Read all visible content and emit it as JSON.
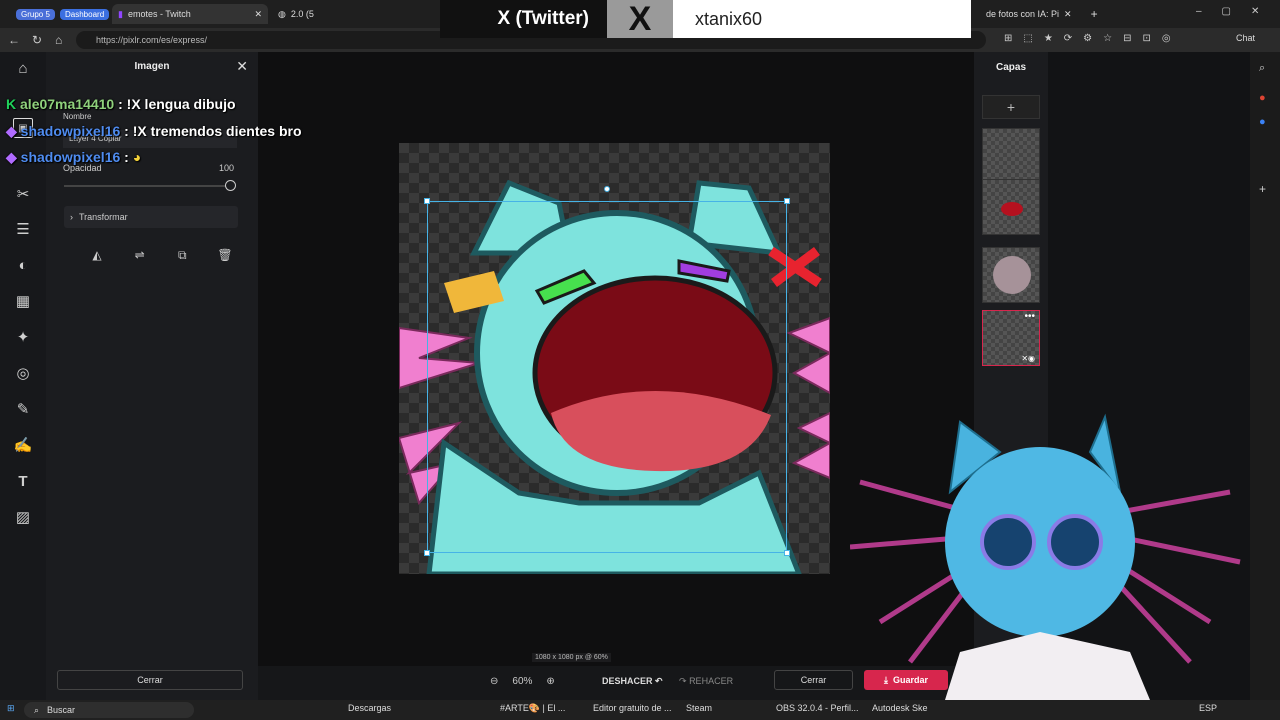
{
  "browser": {
    "tabs": [
      {
        "group": "Grupo 5",
        "group_color": "#4a6fd8"
      },
      {
        "group": "Dashboard",
        "group_color": "#3b6fe0"
      },
      {
        "title": "emotes - Twitch"
      },
      {
        "title": "2.0 (5"
      },
      {
        "title": "de fotos con IA: Pi"
      }
    ],
    "url": "https://pixlr.com/es/express/",
    "chat_button": "Chat"
  },
  "overlay": {
    "twitter_label": "X (Twitter)",
    "twitter_logo": "X",
    "twitter_user": "xtanix60"
  },
  "chat": [
    {
      "user": "ale07ma14410",
      "message": ": !X lengua dibujo",
      "color": "#8fd17c"
    },
    {
      "user": "shadowpixel16",
      "message": ": !X tremendos dientes bro",
      "color": "#4f8cf0"
    },
    {
      "user": "shadowpixel16",
      "message": ":",
      "emote": "pikachu-emote"
    }
  ],
  "panel": {
    "title": "Imagen",
    "name_label": "Nombre",
    "name_value": "Layer 4 Copiar",
    "opacity_label": "Opacidad",
    "opacity_value": "100",
    "transform_label": "Transformar",
    "close_label": "Cerrar"
  },
  "canvas": {
    "status": "1080 x 1080 px @ 60%",
    "zoom": "60%",
    "undo": "DESHACER",
    "redo": "REHACER",
    "close": "Cerrar",
    "save": "Guardar"
  },
  "layers": {
    "title": "Capas",
    "add": "+"
  },
  "taskbar": {
    "search": "Buscar",
    "apps": [
      "Descargas",
      "#ARTE🎨 | El ...",
      "Editor gratuito de ...",
      "Steam",
      "OBS 32.0.4 - Perfil...",
      "Autodesk Ske"
    ],
    "lang": "ESP"
  },
  "colors": {
    "accent": "#d7264d",
    "selection": "#46b3e6",
    "character": "#7ee3dd"
  }
}
